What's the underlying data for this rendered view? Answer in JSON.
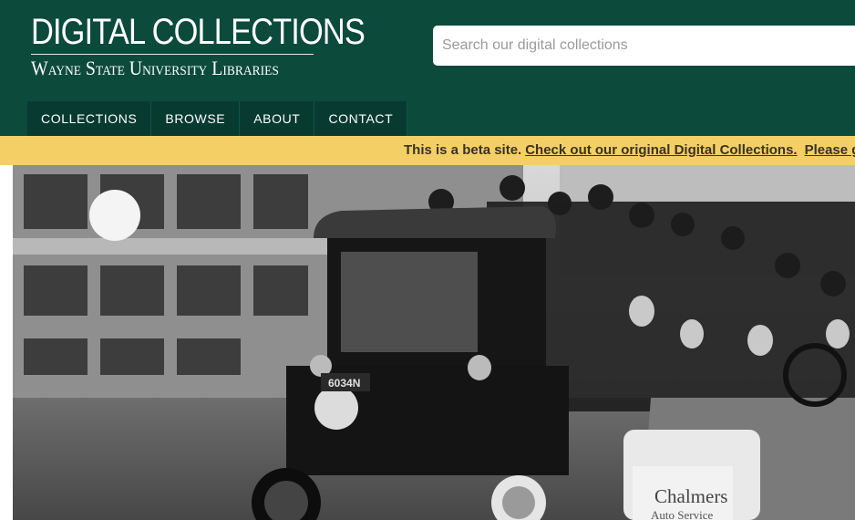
{
  "header": {
    "logo_title": "DIGITAL COLLECTIONS",
    "logo_subtitle": "Wayne State University Libraries",
    "brand_color": "#0c4a3c"
  },
  "search": {
    "placeholder": "Search our digital collections"
  },
  "nav": {
    "items": [
      {
        "label": "COLLECTIONS"
      },
      {
        "label": "BROWSE"
      },
      {
        "label": "ABOUT"
      },
      {
        "label": "CONTACT"
      }
    ]
  },
  "beta_banner": {
    "text": "This is a beta site.",
    "link_label": "Check out our original Digital Collections.",
    "more_link_label": "Please g",
    "background_color": "#f4cf66"
  },
  "hero": {
    "plate_text_1": "Chalmers",
    "plate_text_2": "Auto Service",
    "license_plate": "6034N"
  }
}
